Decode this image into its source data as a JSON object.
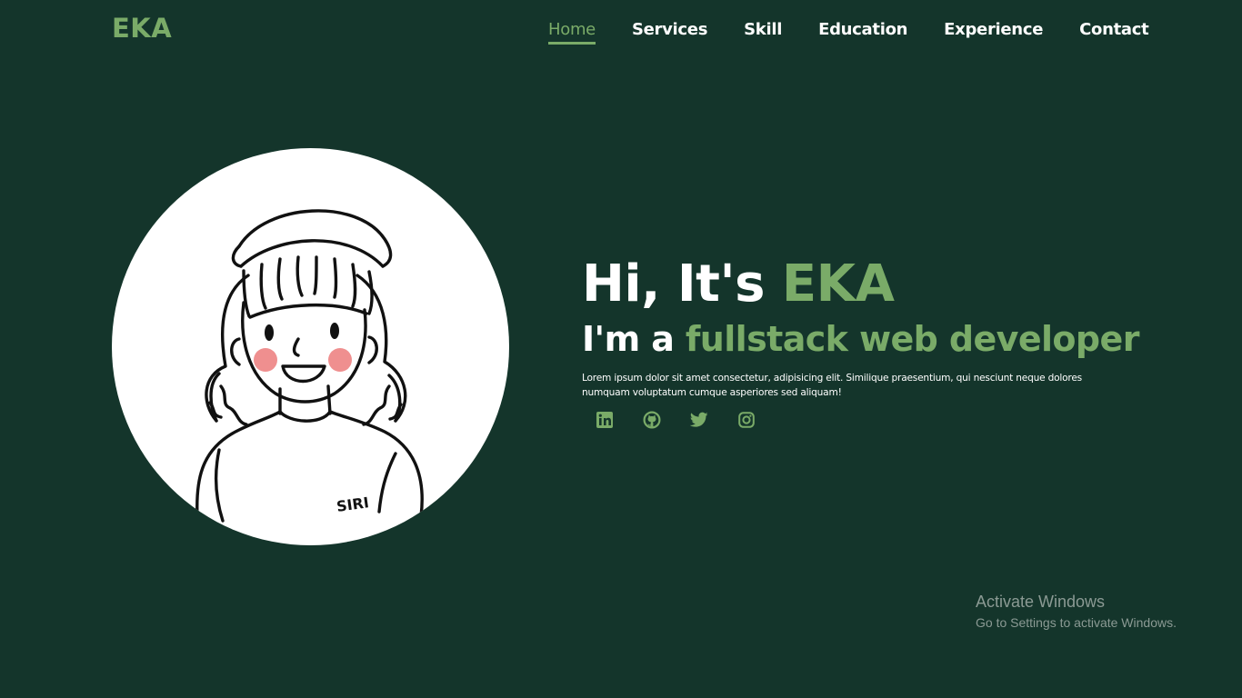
{
  "header": {
    "logo": "EKA",
    "nav": [
      {
        "label": "Home",
        "active": true
      },
      {
        "label": "Services"
      },
      {
        "label": "Skill"
      },
      {
        "label": "Education"
      },
      {
        "label": "Experience"
      },
      {
        "label": "Contact"
      }
    ]
  },
  "hero": {
    "greeting": "Hi, It's ",
    "name": "EKA",
    "role_prefix": "I'm a ",
    "role": "fullstack web developer",
    "description": "Lorem ipsum dolor sit amet consectetur, adipisicing elit. Similique praesentium, qui nesciunt neque dolores numquam voluptatum cumque asperiores sed aliquam!",
    "avatar": {
      "shirt_text": "SIRI",
      "icon": "girl-avatar-illustration"
    },
    "socials": [
      {
        "icon": "linkedin-icon"
      },
      {
        "icon": "github-icon"
      },
      {
        "icon": "twitter-icon"
      },
      {
        "icon": "instagram-icon"
      }
    ]
  },
  "watermark": {
    "title": "Activate Windows",
    "subtitle": "Go to Settings to activate Windows."
  },
  "colors": {
    "background": "#14352b",
    "accent": "#7aab68",
    "text": "#ffffff",
    "blush": "#ef8f8f"
  }
}
